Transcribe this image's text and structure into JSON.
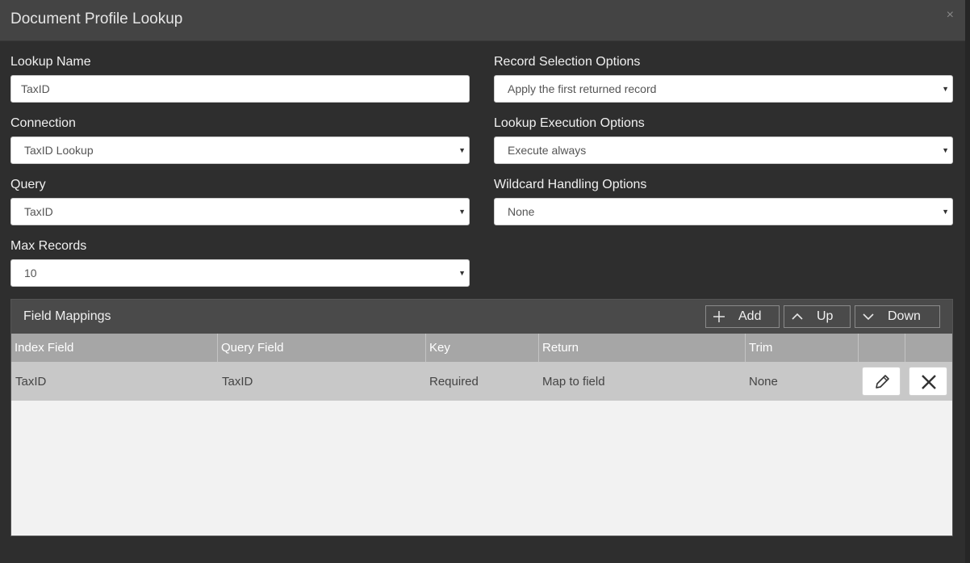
{
  "dialog": {
    "title": "Document Profile Lookup",
    "close_glyph": "×"
  },
  "form": {
    "lookup_name": {
      "label": "Lookup Name",
      "value": "TaxID"
    },
    "connection": {
      "label": "Connection",
      "value": "TaxID Lookup"
    },
    "query": {
      "label": "Query",
      "value": "TaxID"
    },
    "max_records": {
      "label": "Max Records",
      "value": "10"
    },
    "record_selection": {
      "label": "Record Selection Options",
      "value": "Apply the first returned record"
    },
    "lookup_execution": {
      "label": "Lookup Execution Options",
      "value": "Execute always"
    },
    "wildcard_handling": {
      "label": "Wildcard Handling Options",
      "value": "None"
    },
    "select_arrow": "▼"
  },
  "field_mappings": {
    "title": "Field Mappings",
    "add_label": "Add",
    "up_label": "Up",
    "down_label": "Down",
    "columns": [
      "Index Field",
      "Query Field",
      "Key",
      "Return",
      "Trim"
    ],
    "rows": [
      {
        "index_field": "TaxID",
        "query_field": "TaxID",
        "key": "Required",
        "return": "Map to field",
        "trim": "None"
      }
    ]
  },
  "colors": {
    "background": "#2e2e2e",
    "header": "#444444",
    "grid_header": "#a6a6a6",
    "grid_row": "#c8c8c8",
    "panel_body": "#f2f2f2"
  },
  "icons": {
    "close": "close-icon",
    "add": "plus-icon",
    "up": "chevron-up-icon",
    "down": "chevron-down-icon",
    "edit": "pencil-icon",
    "delete": "x-icon"
  }
}
